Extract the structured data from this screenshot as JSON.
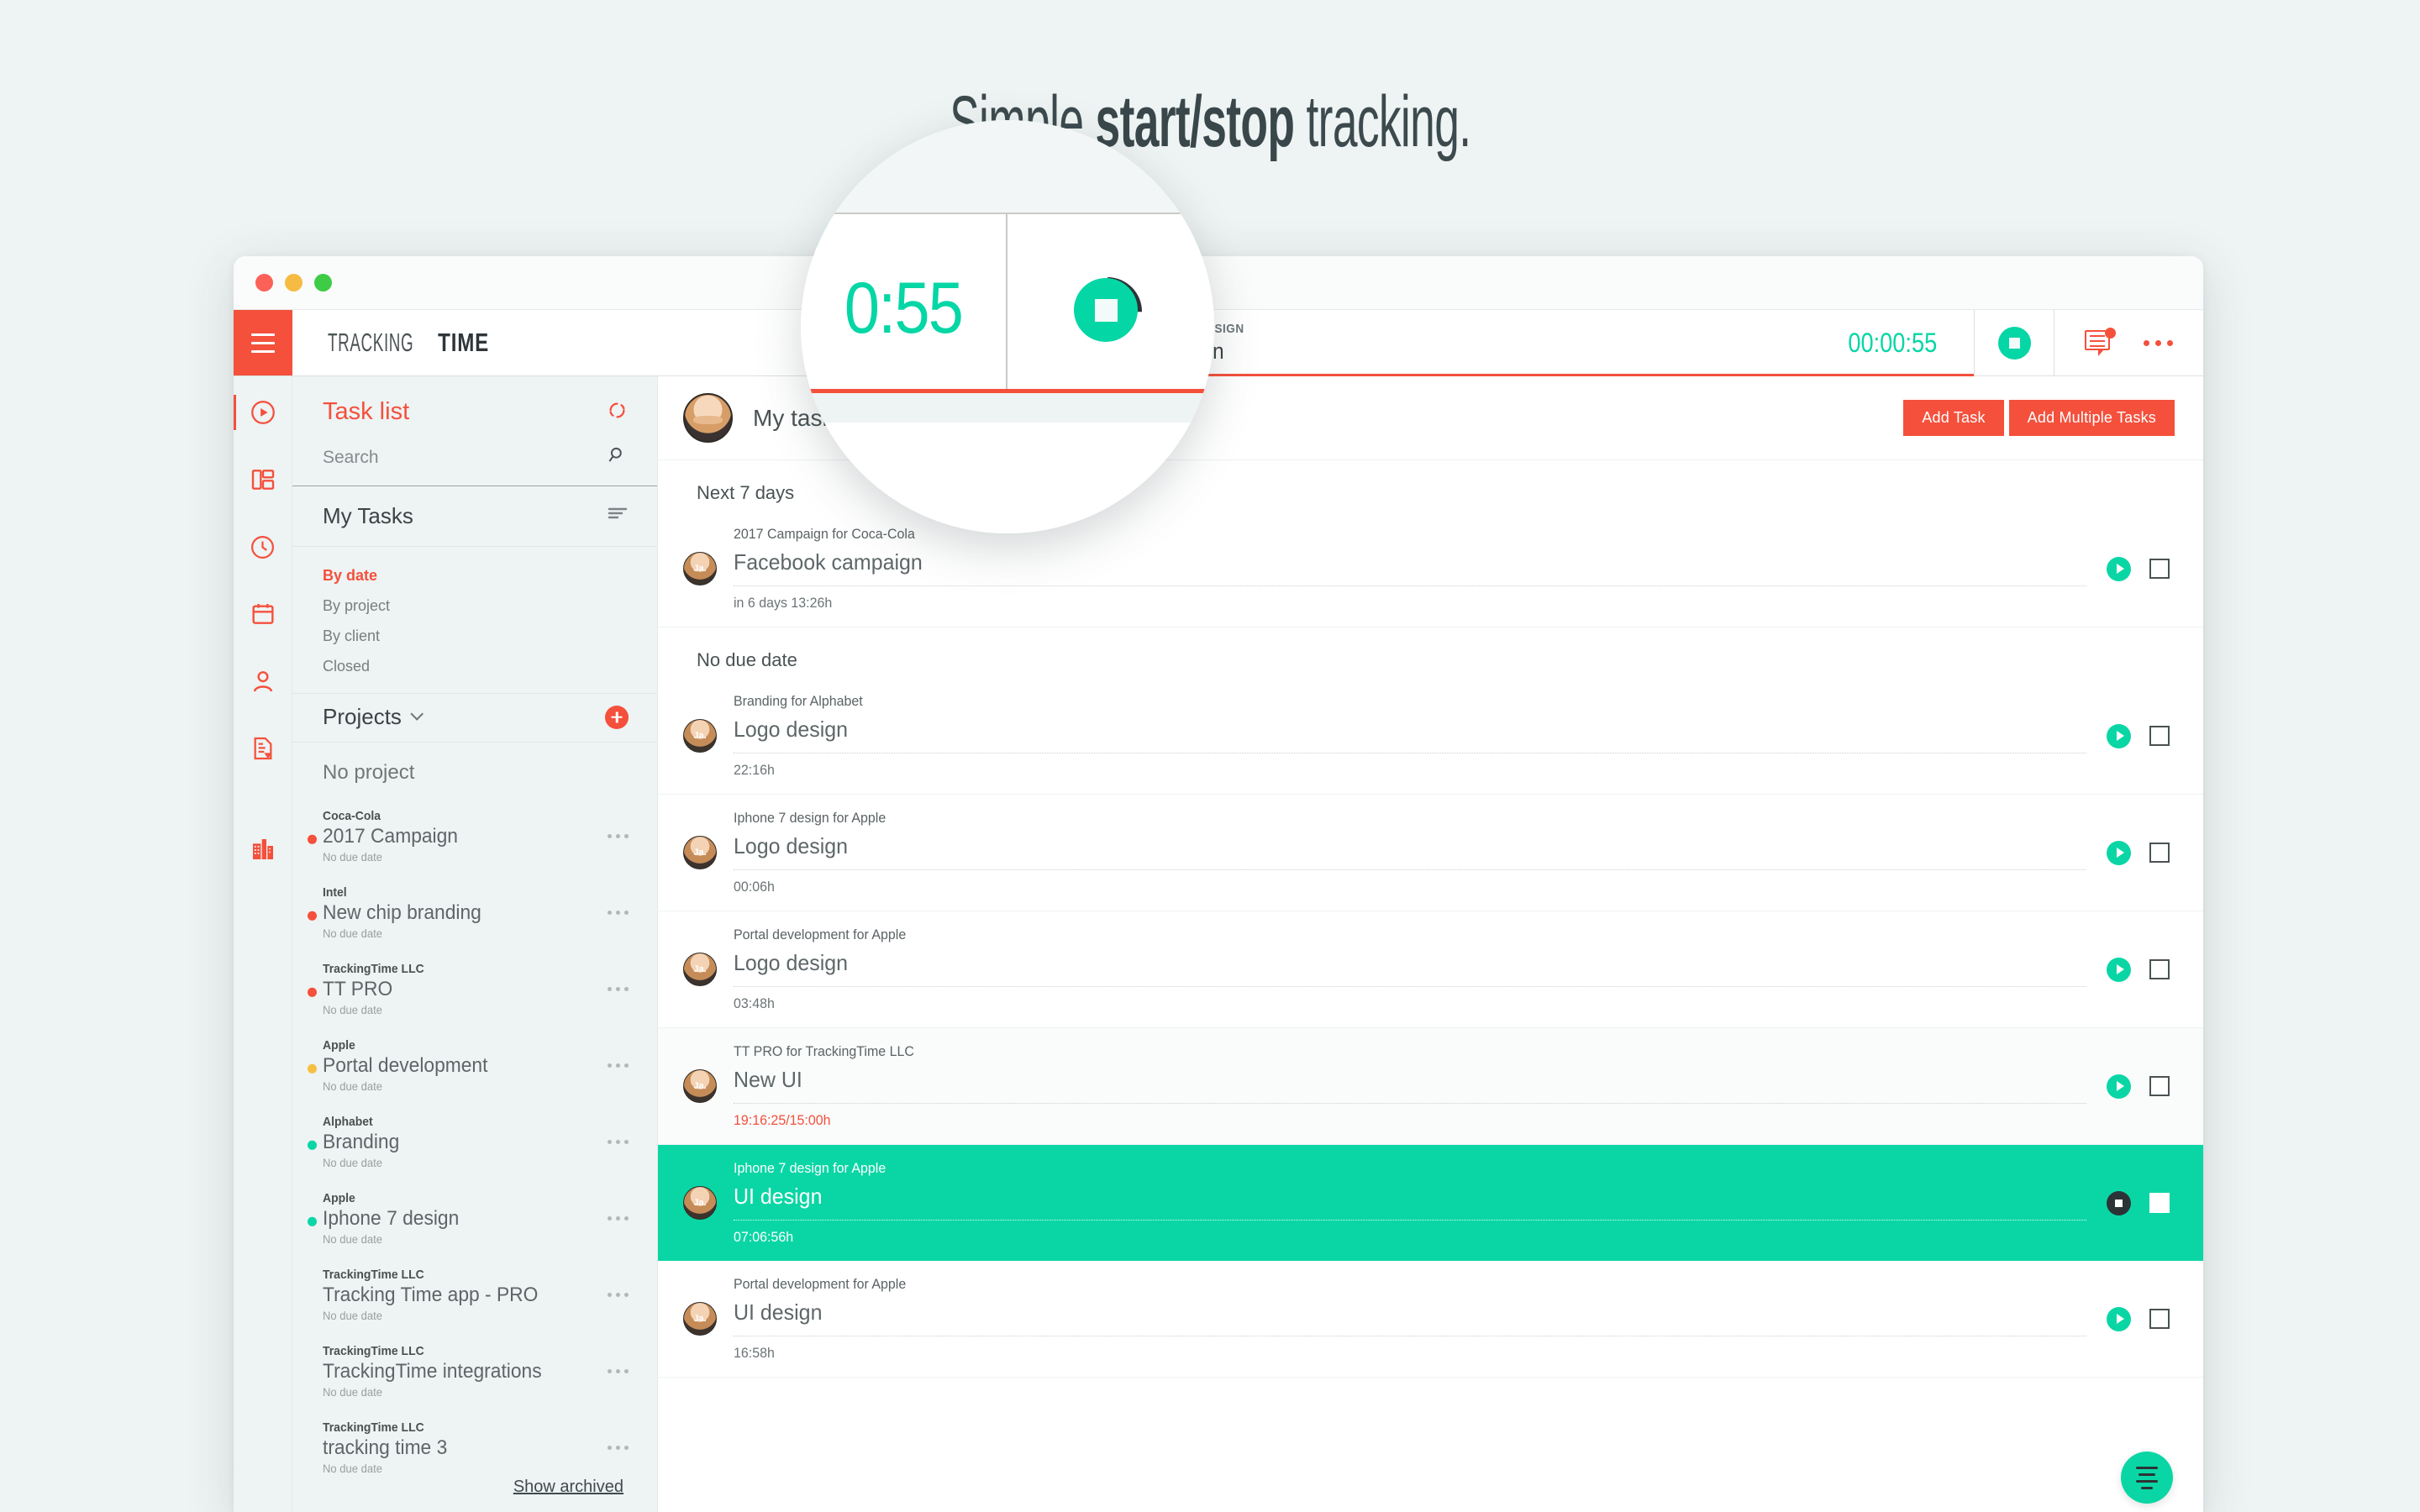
{
  "headline": {
    "prefix": "Simple ",
    "strong": "start/stop",
    "suffix": " tracking."
  },
  "window": {
    "traffic_lights": [
      "close",
      "minimize",
      "maximize"
    ]
  },
  "appbar": {
    "menu_icon": "hamburger-icon",
    "brand_light": "TRACKING",
    "brand_bold": "TIME",
    "dropdown_icon": "chevron-down-icon",
    "timer": {
      "project": "IPHONE 7 DESIGN",
      "task": "UI design",
      "elapsed": "00:00:55",
      "stop_icon": "stop-icon"
    },
    "chat_icon": "chat-notification-icon",
    "more_icon": "ellipsis-icon"
  },
  "rail": {
    "items": [
      {
        "name": "tracker",
        "icon": "play-circle-icon",
        "active": true
      },
      {
        "name": "dashboard",
        "icon": "dashboard-icon",
        "active": false
      },
      {
        "name": "timesheet",
        "icon": "clock-icon",
        "active": false
      },
      {
        "name": "calendar",
        "icon": "calendar-icon",
        "active": false
      },
      {
        "name": "people",
        "icon": "user-icon",
        "active": false
      },
      {
        "name": "reports",
        "icon": "report-icon",
        "active": false
      },
      {
        "name": "company",
        "icon": "building-icon",
        "active": false
      }
    ]
  },
  "tasklist": {
    "title": "Task list",
    "refresh_icon": "refresh-icon",
    "search_placeholder": "Search",
    "search_value": "",
    "search_icon": "search-icon",
    "my_tasks_label": "My Tasks",
    "sort_icon": "sort-icon",
    "filters": [
      {
        "label": "By date",
        "active": true
      },
      {
        "label": "By project",
        "active": false
      },
      {
        "label": "By client",
        "active": false
      },
      {
        "label": "Closed",
        "active": false
      }
    ],
    "projects_label": "Projects",
    "projects_chevron": "chevron-down-icon",
    "add_project_icon": "plus-icon",
    "no_project_label": "No project",
    "projects": [
      {
        "client": "Coca-Cola",
        "name": "2017 Campaign",
        "due": "No due date",
        "color": "#f4503c"
      },
      {
        "client": "Intel",
        "name": "New chip branding",
        "due": "No due date",
        "color": "#f4503c"
      },
      {
        "client": "TrackingTime LLC",
        "name": "TT PRO",
        "due": "No due date",
        "color": "#f4503c"
      },
      {
        "client": "Apple",
        "name": "Portal development",
        "due": "No due date",
        "color": "#f5c042"
      },
      {
        "client": "Alphabet",
        "name": "Branding",
        "due": "No due date",
        "color": "#0ad6a5"
      },
      {
        "client": "Apple",
        "name": "Iphone 7 design",
        "due": "No due date",
        "color": "#0ad6a5"
      },
      {
        "client": "TrackingTime LLC",
        "name": "Tracking Time app - PRO",
        "due": "No due date",
        "color": "transparent"
      },
      {
        "client": "TrackingTime LLC",
        "name": "TrackingTime integrations",
        "due": "No due date",
        "color": "transparent"
      },
      {
        "client": "TrackingTime LLC",
        "name": "tracking time 3",
        "due": "No due date",
        "color": "transparent"
      }
    ],
    "show_archived": "Show archived"
  },
  "main": {
    "header_title": "My tasks",
    "avatar_name": "user-avatar",
    "add_task_label": "Add Task",
    "add_multiple_label": "Add Multiple Tasks",
    "groups": [
      {
        "label": "Next 7 days",
        "tasks": [
          {
            "project": "2017 Campaign for Coca-Cola",
            "title": "Facebook campaign",
            "meta": "in 6 days   13:26h",
            "overdue": false,
            "active": false,
            "shade": false,
            "action_icon": "play-icon",
            "checkbox": "unchecked"
          }
        ]
      },
      {
        "label": "No due date",
        "tasks": [
          {
            "project": "Branding for Alphabet",
            "title": "Logo design",
            "meta": "22:16h",
            "overdue": false,
            "active": false,
            "shade": false,
            "action_icon": "play-icon",
            "checkbox": "unchecked"
          },
          {
            "project": "Iphone 7 design for Apple",
            "title": "Logo design",
            "meta": "00:06h",
            "overdue": false,
            "active": false,
            "shade": false,
            "action_icon": "play-icon",
            "checkbox": "unchecked"
          },
          {
            "project": "Portal development for Apple",
            "title": "Logo design",
            "meta": "03:48h",
            "overdue": false,
            "active": false,
            "shade": false,
            "action_icon": "play-icon",
            "checkbox": "unchecked"
          },
          {
            "project": "TT PRO for TrackingTime LLC",
            "title": "New UI",
            "meta": "19:16:25/15:00h",
            "overdue": true,
            "active": false,
            "shade": true,
            "action_icon": "play-icon",
            "checkbox": "unchecked"
          },
          {
            "project": "Iphone 7 design for Apple",
            "title": "UI design",
            "meta": "07:06:56h",
            "overdue": false,
            "active": true,
            "shade": false,
            "action_icon": "stop-icon",
            "checkbox": "unchecked"
          },
          {
            "project": "Portal development for Apple",
            "title": "UI design",
            "meta": "16:58h",
            "overdue": false,
            "active": false,
            "shade": false,
            "action_icon": "play-icon",
            "checkbox": "unchecked"
          }
        ]
      }
    ],
    "fab_icon": "list-add-icon"
  },
  "magnifier": {
    "zoom_time": "0:55",
    "stop_icon": "stop-icon",
    "progress_ring": "timer-progress-ring"
  },
  "colors": {
    "accent_red": "#f4503c",
    "accent_green": "#0ad6a5",
    "page_bg": "#eef3f3",
    "text_dark": "#3b4346"
  }
}
